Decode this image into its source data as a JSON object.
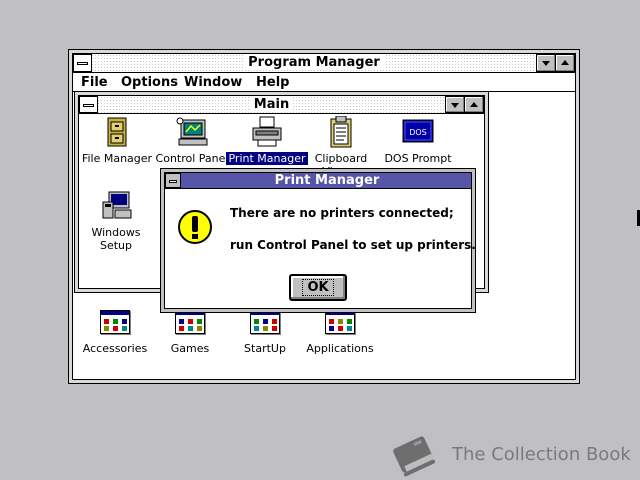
{
  "program_manager": {
    "title": "Program Manager",
    "menu": [
      {
        "label": "File"
      },
      {
        "label": "Options"
      },
      {
        "label": "Window"
      },
      {
        "label": "Help"
      }
    ],
    "group_icons": [
      {
        "label": "Accessories"
      },
      {
        "label": "Games"
      },
      {
        "label": "StartUp"
      },
      {
        "label": "Applications"
      }
    ]
  },
  "main_group": {
    "title": "Main",
    "icons": [
      {
        "label": "File Manager",
        "icon": "file-cabinet-icon"
      },
      {
        "label": "Control Panel",
        "icon": "control-panel-icon"
      },
      {
        "label": "Print Manager",
        "icon": "printer-icon",
        "selected": true
      },
      {
        "label": "Clipboard Viewer",
        "icon": "clipboard-icon"
      },
      {
        "label": "DOS Prompt",
        "icon": "dos-prompt-icon",
        "icon_text": "DOS"
      },
      {
        "label": "Windows Setup",
        "icon": "windows-setup-icon"
      }
    ]
  },
  "dialog": {
    "title": "Print Manager",
    "message_line1": "There are no printers connected;",
    "message_line2": "run Control Panel to set up printers.",
    "ok_label": "OK",
    "icon": "exclamation-icon"
  },
  "watermark": {
    "text": "The Collection Book"
  },
  "colors": {
    "desktop": "#c0c0c4",
    "selection": "#000080",
    "dialog_titlebar": "#5555aa"
  }
}
